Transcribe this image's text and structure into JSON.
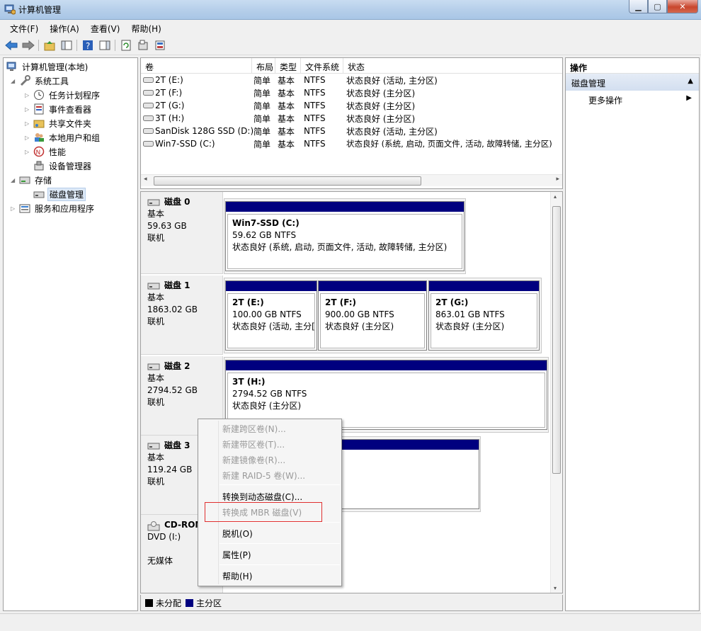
{
  "window": {
    "title": "计算机管理"
  },
  "menu": [
    "文件(F)",
    "操作(A)",
    "查看(V)",
    "帮助(H)"
  ],
  "tree": {
    "root": "计算机管理(本地)",
    "system_tools": "系统工具",
    "task_scheduler": "任务计划程序",
    "event_viewer": "事件查看器",
    "shared_folders": "共享文件夹",
    "local_users": "本地用户和组",
    "performance": "性能",
    "device_manager": "设备管理器",
    "storage": "存储",
    "disk_management": "磁盘管理",
    "services": "服务和应用程序"
  },
  "volume_table": {
    "headers": [
      "卷",
      "布局",
      "类型",
      "文件系统",
      "状态"
    ],
    "rows": [
      [
        "2T (E:)",
        "简单",
        "基本",
        "NTFS",
        "状态良好 (活动, 主分区)"
      ],
      [
        "2T (F:)",
        "简单",
        "基本",
        "NTFS",
        "状态良好 (主分区)"
      ],
      [
        "2T (G:)",
        "简单",
        "基本",
        "NTFS",
        "状态良好 (主分区)"
      ],
      [
        "3T (H:)",
        "简单",
        "基本",
        "NTFS",
        "状态良好 (主分区)"
      ],
      [
        "SanDisk 128G SSD (D:)",
        "简单",
        "基本",
        "NTFS",
        "状态良好 (活动, 主分区)"
      ],
      [
        "Win7-SSD (C:)",
        "简单",
        "基本",
        "NTFS",
        "状态良好 (系统, 启动, 页面文件, 活动, 故障转储, 主分区)"
      ]
    ]
  },
  "disks": [
    {
      "name": "磁盘 0",
      "type": "基本",
      "size": "59.63 GB",
      "status": "联机"
    },
    {
      "name": "磁盘 1",
      "type": "基本",
      "size": "1863.02 GB",
      "status": "联机"
    },
    {
      "name": "磁盘 2",
      "type": "基本",
      "size": "2794.52 GB",
      "status": "联机"
    },
    {
      "name": "磁盘 3",
      "type": "基本",
      "size": "119.24 GB",
      "status": "联机"
    },
    {
      "name": "CD-ROM",
      "type": "DVD (I:)",
      "size": "",
      "status": "无媒体"
    }
  ],
  "partitions": {
    "c": {
      "name": "Win7-SSD  (C:)",
      "size": "59.62 GB NTFS",
      "status": "状态良好 (系统, 启动, 页面文件, 活动, 故障转储, 主分区)"
    },
    "e": {
      "name": "2T  (E:)",
      "size": "100.00 GB NTFS",
      "status": "状态良好 (活动, 主分["
    },
    "f": {
      "name": "2T  (F:)",
      "size": "900.00 GB NTFS",
      "status": "状态良好 (主分区)"
    },
    "g": {
      "name": "2T  (G:)",
      "size": "863.01 GB NTFS",
      "status": "状态良好 (主分区)"
    },
    "h": {
      "name": "3T  (H:)",
      "size": "2794.52 GB NTFS",
      "status": "状态良好 (主分区)"
    }
  },
  "legend": {
    "unallocated": "未分配",
    "primary": "主分区"
  },
  "actions": {
    "header": "操作",
    "section": "磁盘管理",
    "more": "更多操作"
  },
  "context_menu": [
    "新建跨区卷(N)...",
    "新建带区卷(T)...",
    "新建镜像卷(R)...",
    "新建 RAID-5 卷(W)...",
    "转换到动态磁盘(C)...",
    "转换成 MBR 磁盘(V)",
    "脱机(O)",
    "属性(P)",
    "帮助(H)"
  ],
  "colors": {
    "primary_partition": "#00007f",
    "unallocated": "#000000",
    "highlight": "#e03030"
  }
}
